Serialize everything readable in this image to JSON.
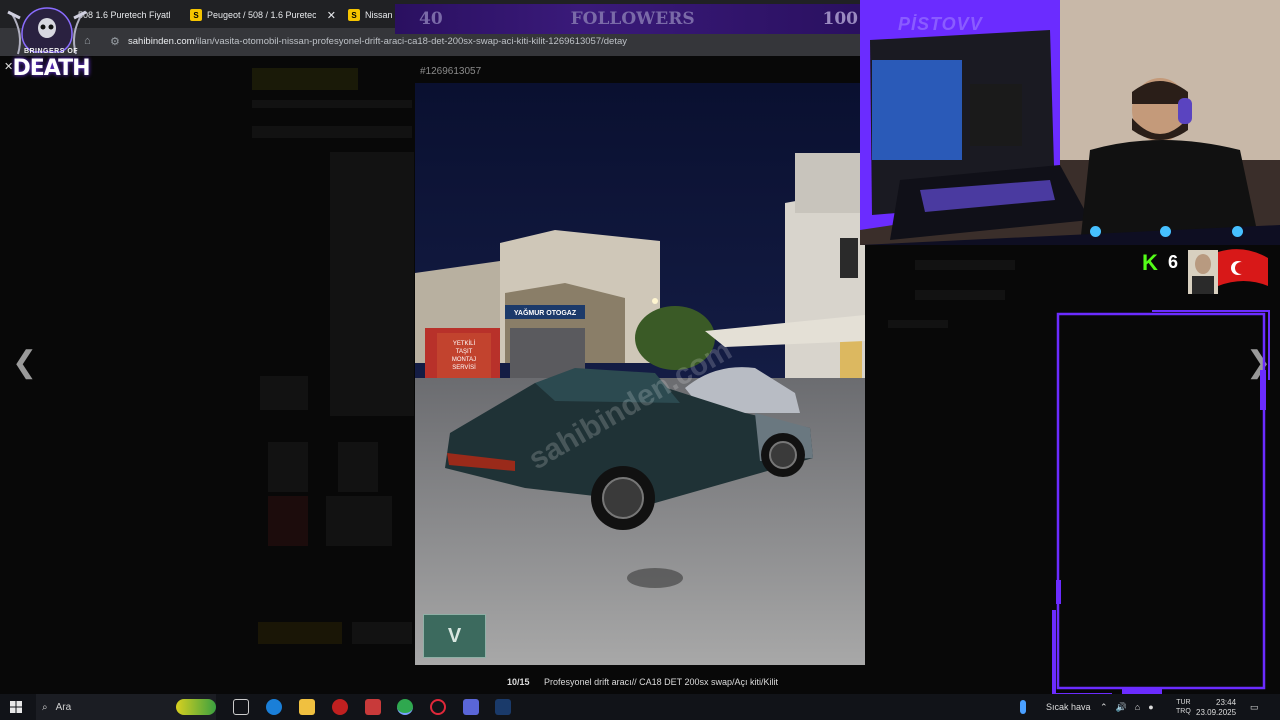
{
  "browser": {
    "tabs": [
      {
        "favicon": "S",
        "label": "508 1.6 Puretech Fiyatl"
      },
      {
        "favicon": "S",
        "label": "Peugeot / 508 / 1.6 Puretech / ("
      },
      {
        "favicon": "S",
        "label": "Nissan"
      }
    ],
    "url_host": "sahibinden.com",
    "url_path": "/ilan/vasita-otomobil-nissan-profesyonel-drift-araci-ca18-det-200sx-swap-aci-kiti-kilit-1269613057/detay"
  },
  "lightbox": {
    "listing_id": "#1269613057",
    "counter": "10/15",
    "caption": "Profesyonel drift aracı// CA18 DET 200sx swap/Açı kiti/Kilit",
    "prev_icon": "chevron-left-icon",
    "next_icon": "chevron-right-icon",
    "photo_signs": {
      "dealer": "YAĞMUR OTOGAZ",
      "service_1": "YETKİLİ",
      "service_2": "TAŞIT",
      "service_3": "MONTAJ",
      "service_4": "SERVİSİ",
      "watermark": "sahibinden.com"
    },
    "thumb_label": "V"
  },
  "overlay": {
    "followers_count": "40",
    "followers_label": "FOLLOWERS",
    "followers_goal": "100",
    "logo_line1": "BRINGERS OF",
    "logo_line2": "DEATH",
    "streamer_name": "PİSTOVV",
    "kick_logo": "K",
    "kick_count": "6",
    "social_icons": [
      "twitter-icon",
      "instagram-icon",
      "youtube-icon"
    ]
  },
  "taskbar": {
    "search_placeholder": "Ara",
    "weather": "Sıcak hava",
    "lang_top": "TUR",
    "lang_bottom": "TRQ",
    "time": "23:44",
    "date": "23.09.2025"
  },
  "colors": {
    "accent_purple": "#6b2cff",
    "kick_green": "#53fc18",
    "followers_bg": "#2a1060"
  }
}
